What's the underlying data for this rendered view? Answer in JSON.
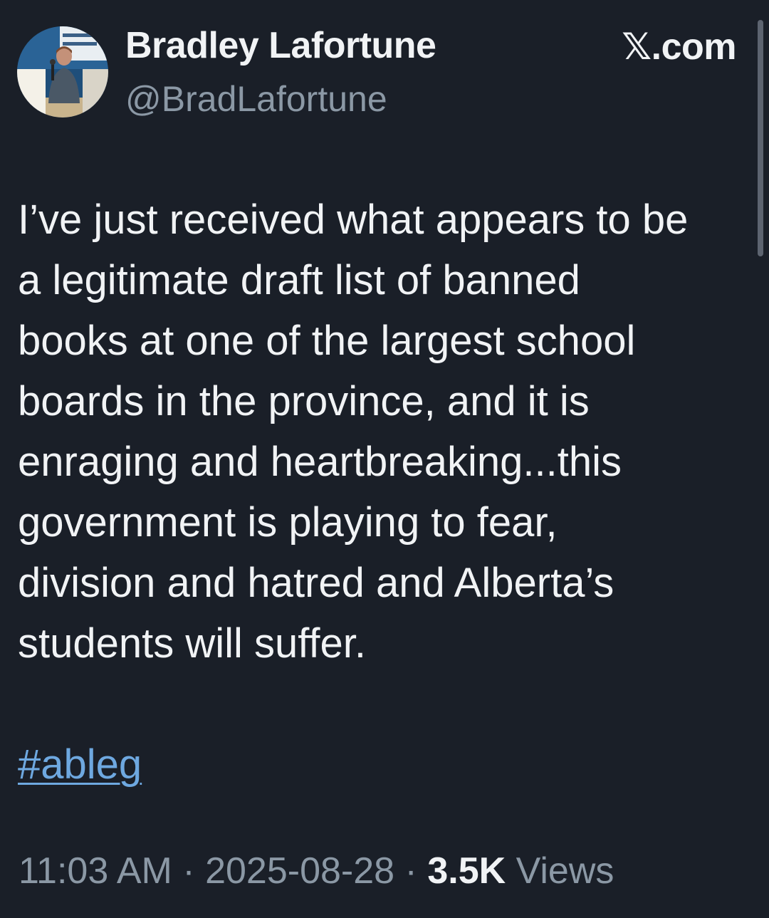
{
  "header": {
    "display_name": "Bradley Lafortune",
    "handle": "@BradLafortune",
    "source": "𝕏.com",
    "avatar_icon": "profile-photo-icon"
  },
  "tweet": {
    "lines": [
      "I’ve just received what appears to be",
      "a legitimate draft list of banned",
      "books at one of the largest school",
      "boards in the province, and it is",
      "enraging and heartbreaking...this",
      "government is playing to fear,",
      "division and hatred and Alberta’s",
      "students will suffer."
    ],
    "hashtag": "#ableg"
  },
  "meta": {
    "time": "11:03 AM",
    "separator": "·",
    "date": "2025-08-28",
    "views_count": "3.5K",
    "views_label": "Views"
  },
  "colors": {
    "background": "#1a1f28",
    "text": "#f1f3f5",
    "muted": "#8b98a5",
    "link": "#6ea8e0"
  }
}
